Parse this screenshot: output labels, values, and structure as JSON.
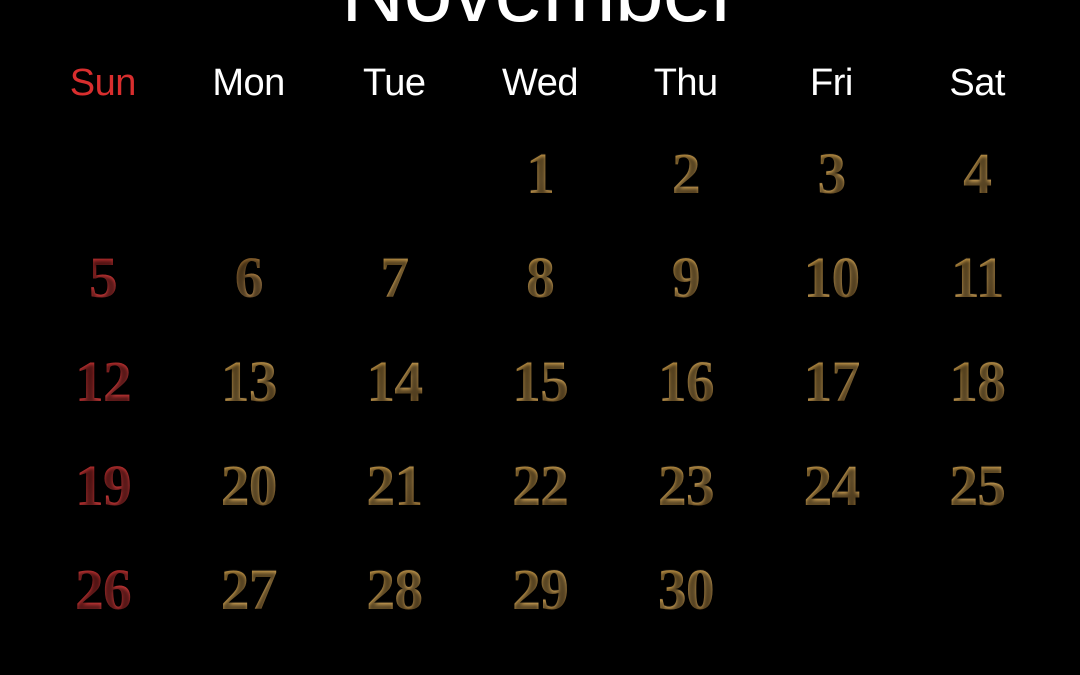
{
  "month_title": "November",
  "day_headers": [
    {
      "label": "Sun",
      "sunday": true
    },
    {
      "label": "Mon",
      "sunday": false
    },
    {
      "label": "Tue",
      "sunday": false
    },
    {
      "label": "Wed",
      "sunday": false
    },
    {
      "label": "Thu",
      "sunday": false
    },
    {
      "label": "Fri",
      "sunday": false
    },
    {
      "label": "Sat",
      "sunday": false
    }
  ],
  "dates": [
    {
      "value": "",
      "style": "empty"
    },
    {
      "value": "",
      "style": "empty"
    },
    {
      "value": "",
      "style": "empty"
    },
    {
      "value": "1",
      "style": "wood"
    },
    {
      "value": "2",
      "style": "wood"
    },
    {
      "value": "3",
      "style": "wood"
    },
    {
      "value": "4",
      "style": "wood"
    },
    {
      "value": "5",
      "style": "red"
    },
    {
      "value": "6",
      "style": "wood-dark"
    },
    {
      "value": "7",
      "style": "wood"
    },
    {
      "value": "8",
      "style": "wood"
    },
    {
      "value": "9",
      "style": "wood"
    },
    {
      "value": "10",
      "style": "wood"
    },
    {
      "value": "11",
      "style": "wood"
    },
    {
      "value": "12",
      "style": "red"
    },
    {
      "value": "13",
      "style": "wood"
    },
    {
      "value": "14",
      "style": "wood"
    },
    {
      "value": "15",
      "style": "wood"
    },
    {
      "value": "16",
      "style": "wood"
    },
    {
      "value": "17",
      "style": "wood"
    },
    {
      "value": "18",
      "style": "wood"
    },
    {
      "value": "19",
      "style": "red"
    },
    {
      "value": "20",
      "style": "wood"
    },
    {
      "value": "21",
      "style": "wood"
    },
    {
      "value": "22",
      "style": "wood"
    },
    {
      "value": "23",
      "style": "wood"
    },
    {
      "value": "24",
      "style": "wood"
    },
    {
      "value": "25",
      "style": "wood"
    },
    {
      "value": "26",
      "style": "red"
    },
    {
      "value": "27",
      "style": "wood"
    },
    {
      "value": "28",
      "style": "wood"
    },
    {
      "value": "29",
      "style": "wood"
    },
    {
      "value": "30",
      "style": "wood"
    },
    {
      "value": "",
      "style": "empty"
    },
    {
      "value": "",
      "style": "empty"
    }
  ],
  "colors": {
    "background": "#000000",
    "header_text": "#ffffff",
    "sunday_header": "#d82e2e",
    "wood_light": "#d9a858",
    "wood_dark": "#8a5f28",
    "red_date": "#cc3a3a"
  }
}
